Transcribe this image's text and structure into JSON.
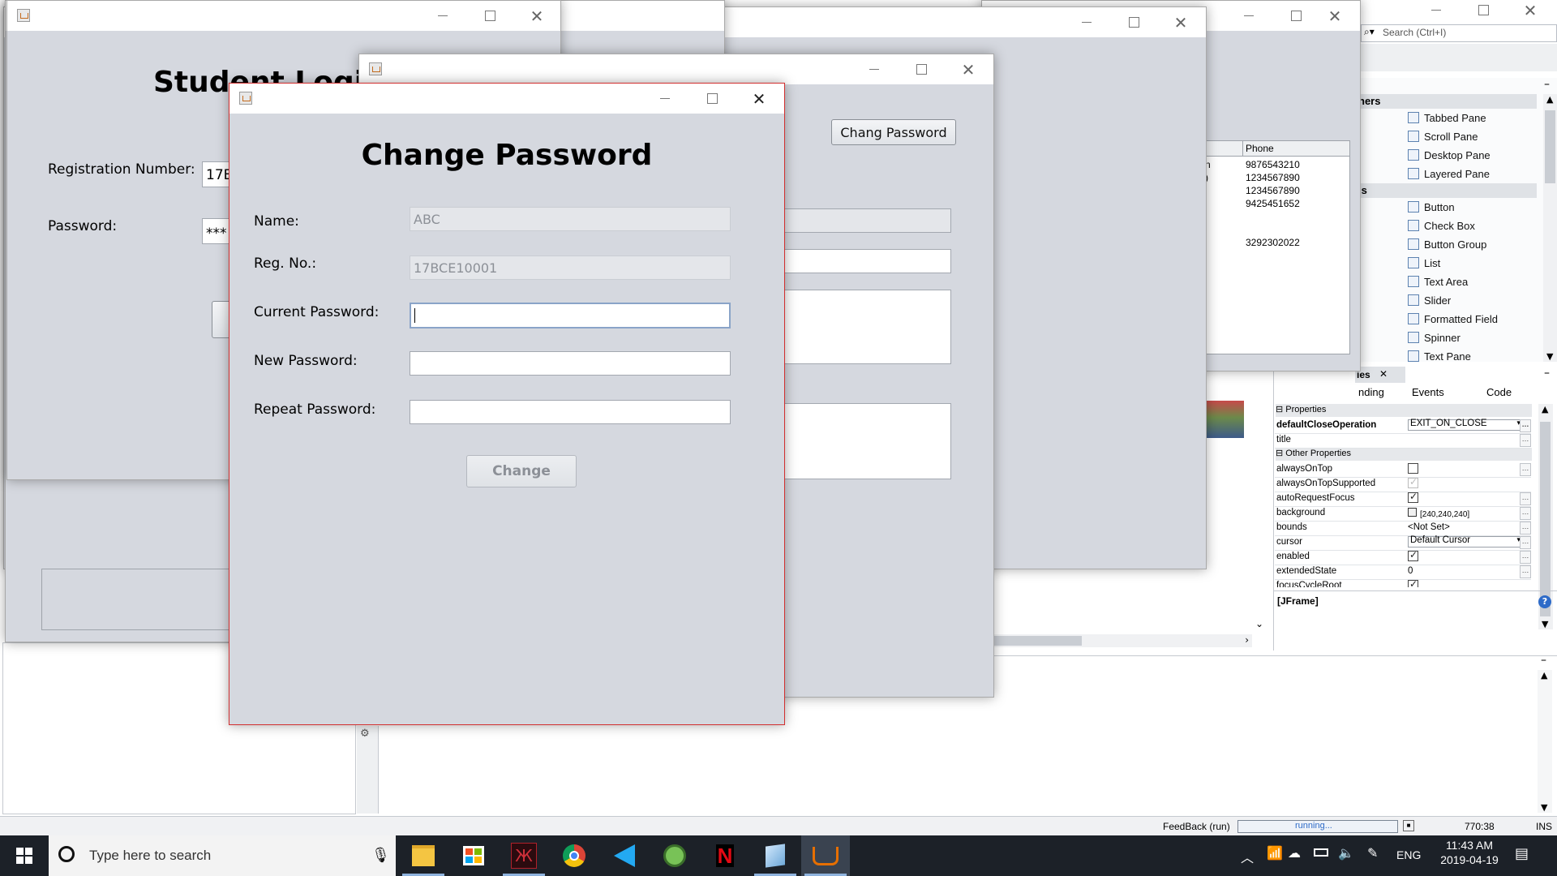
{
  "ide": {
    "search_placeholder": "Search (Ctrl+I)",
    "palette": {
      "section_containers": "ners",
      "section_controls": "ls",
      "containers": [
        "Tabbed Pane",
        "Scroll Pane",
        "Desktop Pane",
        "Layered Pane"
      ],
      "controls": [
        "Button",
        "Check Box",
        "Button Group",
        "List",
        "Text Area",
        "Slider",
        "Formatted Field",
        "Spinner",
        "Text Pane"
      ]
    },
    "props": {
      "tab_title": "ies",
      "tabs": [
        "nding",
        "Events",
        "Code"
      ],
      "section_properties": "Properties",
      "section_other": "Other Properties",
      "rows": [
        {
          "name": "defaultCloseOperation",
          "value": "EXIT_ON_CLOSE"
        },
        {
          "name": "title",
          "value": ""
        }
      ],
      "other_rows": [
        {
          "name": "alwaysOnTop",
          "value": ""
        },
        {
          "name": "alwaysOnTopSupported",
          "value": ""
        },
        {
          "name": "autoRequestFocus",
          "value": ""
        },
        {
          "name": "background",
          "value": "[240,240,240]"
        },
        {
          "name": "bounds",
          "value": "<Not Set>"
        },
        {
          "name": "cursor",
          "value": "Default Cursor"
        },
        {
          "name": "enabled",
          "value": ""
        },
        {
          "name": "extendedState",
          "value": "0"
        },
        {
          "name": "focusCycleRoot",
          "value": ""
        }
      ],
      "footer": "[JFrame]"
    },
    "statusbar": {
      "feedback": "FeedBack (run)",
      "running": "running...",
      "position": "770:38",
      "mode": "INS"
    }
  },
  "table_window": {
    "column_header": "Phone",
    "partial_cells": [
      "n",
      ")"
    ],
    "phones": [
      "9876543210",
      "1234567890",
      "1234567890",
      "9425451652",
      "",
      "",
      "3292302022"
    ]
  },
  "dashboard_window": {
    "chang_password_button": "Chang Password"
  },
  "login_window": {
    "title": "Student Login",
    "reg_label": "Registration Number:",
    "reg_value": "17B",
    "password_label": "Password:",
    "password_value": "***"
  },
  "change_password_dialog": {
    "heading": "Change Password",
    "name_label": "Name:",
    "name_value": "ABC",
    "reg_label": "Reg. No.:",
    "reg_value": "17BCE10001",
    "current_label": "Current Password:",
    "current_value": "",
    "new_label": "New Password:",
    "new_value": "",
    "repeat_label": "Repeat Password:",
    "repeat_value": "",
    "change_button": "Change"
  },
  "taskbar": {
    "search_placeholder": "Type here to search",
    "language": "ENG",
    "time": "11:43 AM",
    "date": "2019-04-19",
    "apps": [
      "file-explorer-icon",
      "store-icon",
      "game-icon",
      "chrome-icon",
      "vscode-icon",
      "android-studio-icon",
      "netflix-icon",
      "box-app-icon",
      "java-icon"
    ]
  }
}
